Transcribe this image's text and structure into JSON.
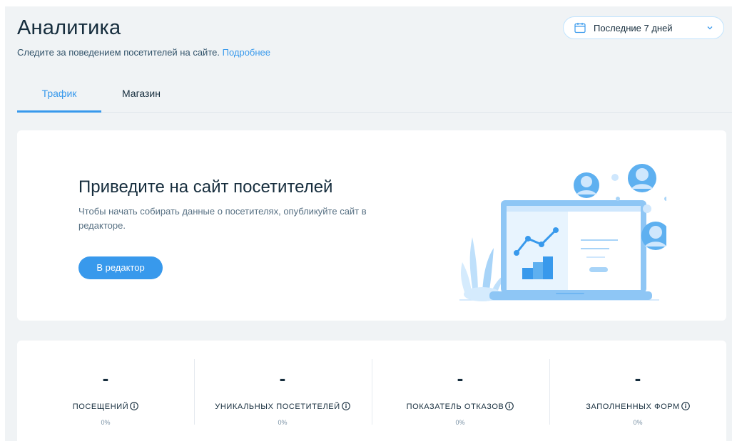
{
  "header": {
    "title": "Аналитика",
    "subtitle": "Следите за поведением посетителей на сайте.",
    "more_link": "Подробнее"
  },
  "date_picker": {
    "label": "Последние 7 дней",
    "icon": "calendar-icon"
  },
  "tabs": [
    {
      "label": "Трафик",
      "active": true
    },
    {
      "label": "Магазин",
      "active": false
    }
  ],
  "hero": {
    "title": "Приведите на сайт посетителей",
    "text": "Чтобы начать собирать данные о посетителях, опубликуйте сайт в редакторе.",
    "button_label": "В редактор"
  },
  "stats": [
    {
      "value": "-",
      "label": "ПОСЕЩЕНИЙ",
      "pct": "0%"
    },
    {
      "value": "-",
      "label": "УНИКАЛЬНЫХ ПОСЕТИТЕЛЕЙ",
      "pct": "0%"
    },
    {
      "value": "-",
      "label": "ПОКАЗАТЕЛЬ ОТКАЗОВ",
      "pct": "0%"
    },
    {
      "value": "-",
      "label": "ЗАПОЛНЕННЫХ ФОРМ",
      "pct": "0%"
    }
  ],
  "colors": {
    "accent": "#3899ec",
    "background": "#f0f3f5",
    "title": "#162d3d"
  }
}
